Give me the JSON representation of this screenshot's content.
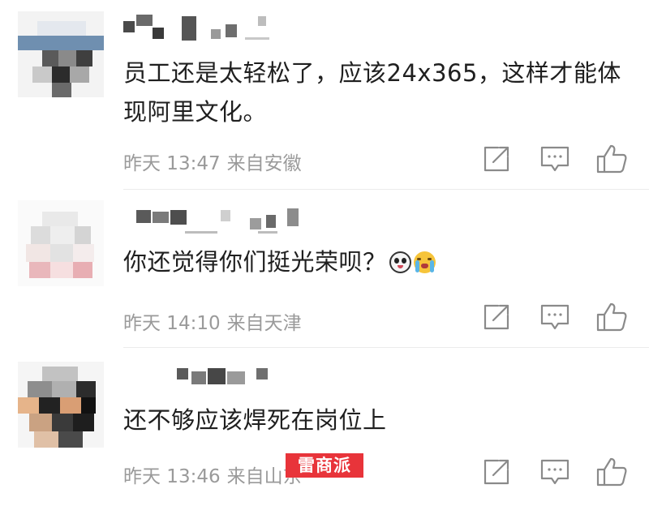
{
  "comments": [
    {
      "text": "员工还是太轻松了，应该24x365，这样才能体现阿里文化。",
      "time": "昨天 13:47",
      "location": "来自安徽"
    },
    {
      "text": "你还觉得你们挺光荣呗？",
      "emojis": [
        "panda-face-emoji",
        "crying-face-emoji"
      ],
      "time": "昨天 14:10",
      "location": "来自天津"
    },
    {
      "text": "还不够应该焊死在岗位上",
      "time": "昨天 13:46",
      "location": "来自山东"
    }
  ],
  "action_icons": [
    "share-icon",
    "comment-icon",
    "like-icon"
  ],
  "watermark": "雷商派",
  "colors": {
    "meta_text": "#9a9a9a",
    "body_text": "#1f1f1f",
    "icon_stroke": "#8a8a8a",
    "watermark_bg": "#e8343a"
  }
}
